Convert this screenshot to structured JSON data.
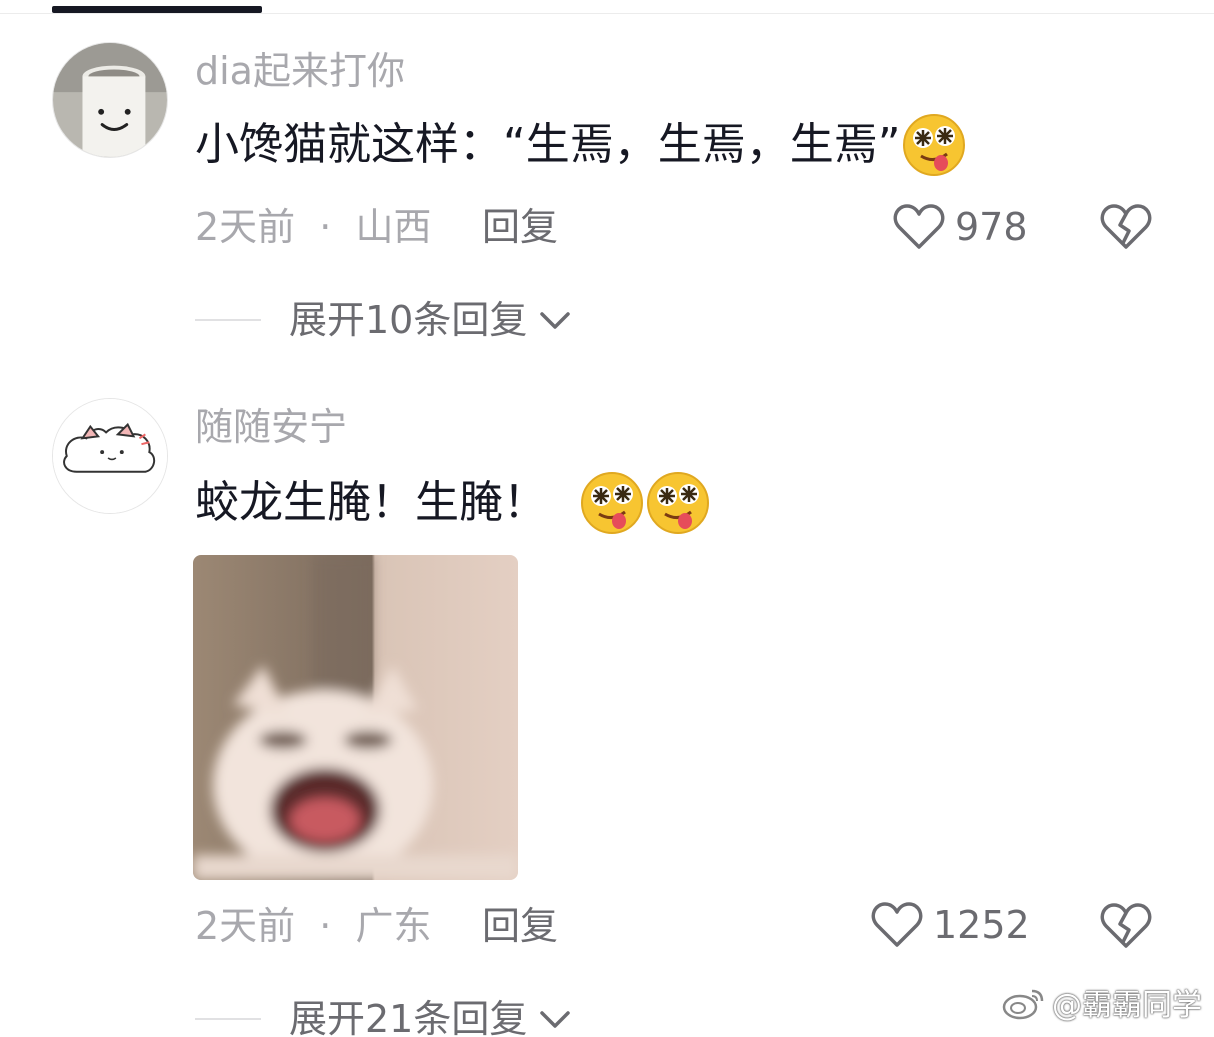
{
  "comments": [
    {
      "username": "dia起来打你",
      "text": "小馋猫就这样：“生焉，生焉，生焉”",
      "emoji_icons": [
        "drooling-face-icon"
      ],
      "time": "2天前",
      "separator": "·",
      "location": "山西",
      "reply_label": "回复",
      "likes": "978",
      "expand_label": "展开10条回复"
    },
    {
      "username": "随随安宁",
      "text": "蛟龙生腌！生腌！",
      "emoji_icons": [
        "drooling-face-icon",
        "drooling-face-icon"
      ],
      "has_image": true,
      "time": "2天前",
      "separator": "·",
      "location": "广东",
      "reply_label": "回复",
      "likes": "1252",
      "expand_label": "展开21条回复"
    }
  ],
  "watermark": {
    "text": "@霸霸同学",
    "icon": "weibo-icon"
  },
  "colors": {
    "primary_text": "#161823",
    "secondary_text": "#a8a8ad",
    "action_text": "#6b6b70",
    "background": "#ffffff"
  }
}
